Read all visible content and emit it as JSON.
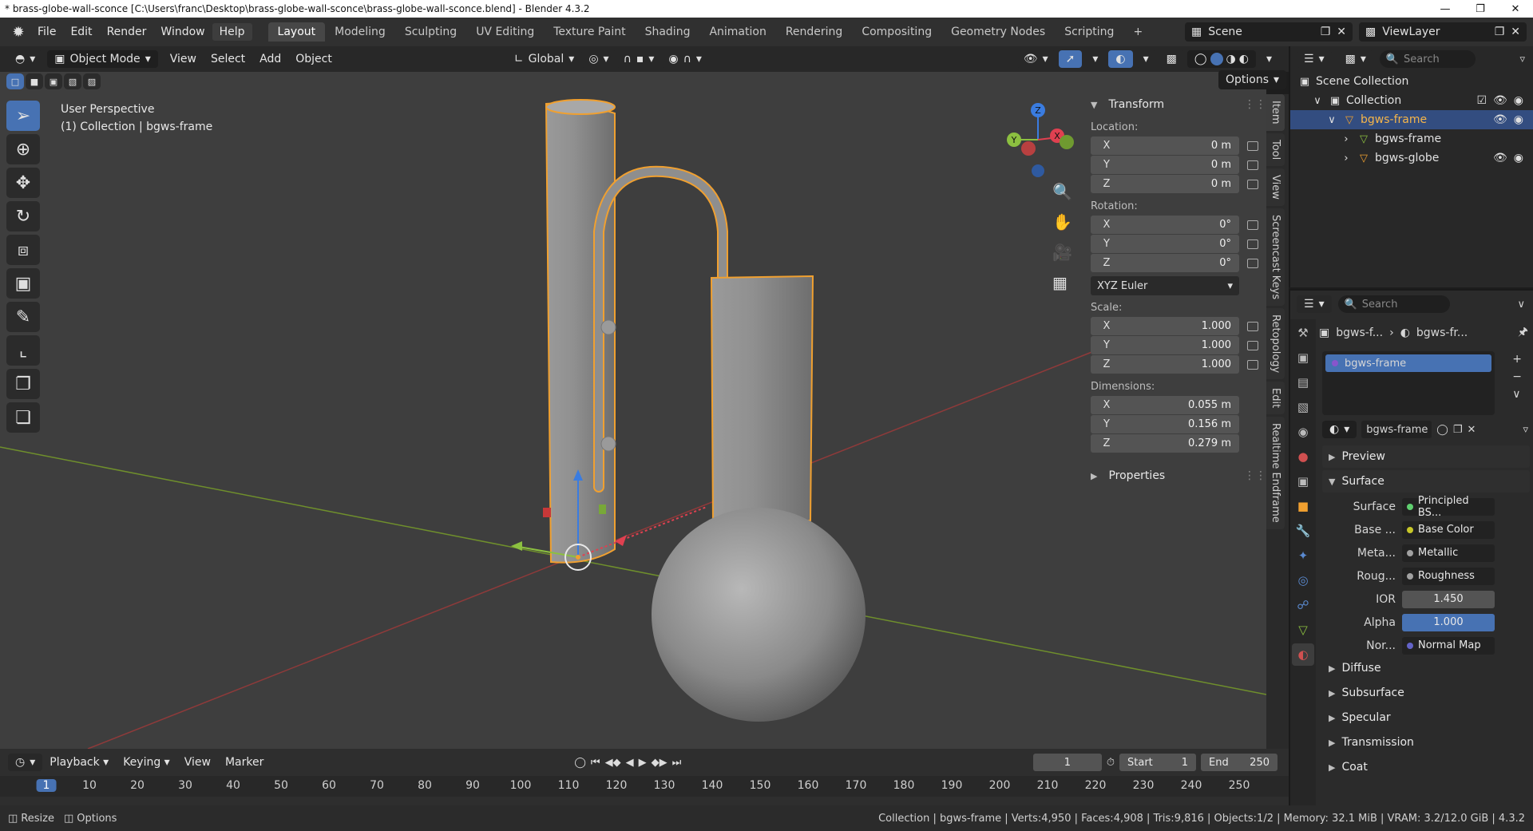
{
  "window": {
    "title": "* brass-globe-wall-sconce [C:\\Users\\franc\\Desktop\\brass-globe-wall-sconce\\brass-globe-wall-sconce.blend] - Blender 4.3.2"
  },
  "menu": {
    "items": [
      "File",
      "Edit",
      "Render",
      "Window",
      "Help"
    ]
  },
  "workspaces": [
    "Layout",
    "Modeling",
    "Sculpting",
    "UV Editing",
    "Texture Paint",
    "Shading",
    "Animation",
    "Rendering",
    "Compositing",
    "Geometry Nodes",
    "Scripting"
  ],
  "scene": {
    "name": "Scene",
    "view_layer": "ViewLayer"
  },
  "viewport_header": {
    "mode": "Object Mode",
    "menus": [
      "View",
      "Select",
      "Add",
      "Object"
    ],
    "orientation": "Global",
    "options": "Options"
  },
  "viewport": {
    "perspective": "User Perspective",
    "context": "(1) Collection | bgws-frame"
  },
  "gizmo": {
    "x": "X",
    "y": "Y",
    "z": "Z"
  },
  "npanel": {
    "transform_title": "Transform",
    "location_label": "Location:",
    "location": [
      {
        "axis": "X",
        "value": "0 m"
      },
      {
        "axis": "Y",
        "value": "0 m"
      },
      {
        "axis": "Z",
        "value": "0 m"
      }
    ],
    "rotation_label": "Rotation:",
    "rotation": [
      {
        "axis": "X",
        "value": "0°"
      },
      {
        "axis": "Y",
        "value": "0°"
      },
      {
        "axis": "Z",
        "value": "0°"
      }
    ],
    "rotation_mode": "XYZ Euler",
    "scale_label": "Scale:",
    "scale": [
      {
        "axis": "X",
        "value": "1.000"
      },
      {
        "axis": "Y",
        "value": "1.000"
      },
      {
        "axis": "Z",
        "value": "1.000"
      }
    ],
    "dimensions_label": "Dimensions:",
    "dimensions": [
      {
        "axis": "X",
        "value": "0.055 m"
      },
      {
        "axis": "Y",
        "value": "0.156 m"
      },
      {
        "axis": "Z",
        "value": "0.279 m"
      }
    ],
    "properties_title": "Properties"
  },
  "sidetabs": [
    "Item",
    "Tool",
    "View",
    "Screencast Keys",
    "Retopology",
    "Edit",
    "Realtime Endframe"
  ],
  "outliner": {
    "search_placeholder": "Search",
    "rows": [
      "Scene Collection",
      "Collection",
      "bgws-frame",
      "bgws-frame",
      "bgws-globe"
    ]
  },
  "properties": {
    "search_placeholder": "Search",
    "breadcrumb_obj": "bgws-f...",
    "breadcrumb_mat": "bgws-fr...",
    "slot": "bgws-frame",
    "material_name": "bgws-frame",
    "preview": "Preview",
    "surface_section": "Surface",
    "surface_label": "Surface",
    "surface_value": "Principled BS...",
    "inputs": [
      {
        "label": "Base ...",
        "value": "Base Color",
        "color": "#c7c729"
      },
      {
        "label": "Meta...",
        "value": "Metallic",
        "color": "#a1a1a1"
      },
      {
        "label": "Roug...",
        "value": "Roughness",
        "color": "#a1a1a1"
      }
    ],
    "ior_label": "IOR",
    "ior_value": "1.450",
    "alpha_label": "Alpha",
    "alpha_value": "1.000",
    "normal_label": "Nor...",
    "normal_value": "Normal Map",
    "subsections": [
      "Diffuse",
      "Subsurface",
      "Specular",
      "Transmission",
      "Coat"
    ]
  },
  "timeline": {
    "menus": [
      "Playback",
      "Keying",
      "View",
      "Marker"
    ],
    "current_frame": "1",
    "start_label": "Start",
    "start": "1",
    "end_label": "End",
    "end": "250",
    "ticks": [
      "1",
      "10",
      "20",
      "30",
      "40",
      "50",
      "60",
      "70",
      "80",
      "90",
      "100",
      "110",
      "120",
      "130",
      "140",
      "150",
      "160",
      "170",
      "180",
      "190",
      "200",
      "210",
      "220",
      "230",
      "240",
      "250"
    ]
  },
  "status": {
    "left1": "Resize",
    "left2": "Options",
    "info": "Collection | bgws-frame | Verts:4,950 | Faces:4,908 | Tris:9,816 | Objects:1/2 | Memory: 32.1 MiB | VRAM: 3.2/12.0 GiB | 4.3.2"
  },
  "colors": {
    "accent": "#4772b3",
    "select_orange": "#f0a030",
    "x_axis": "#e04050",
    "y_axis": "#8cc040",
    "z_axis": "#3a7ce0"
  }
}
